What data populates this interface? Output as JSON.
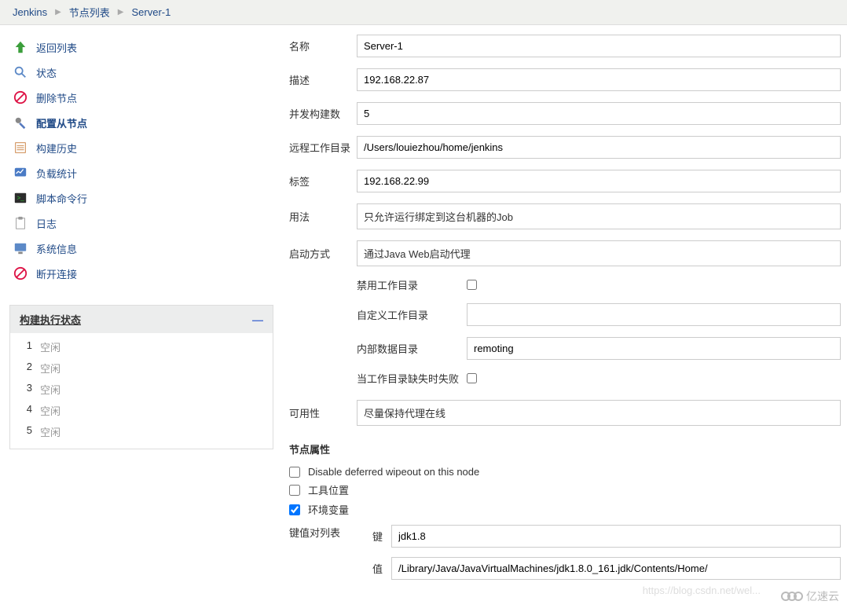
{
  "breadcrumb": [
    {
      "label": "Jenkins"
    },
    {
      "label": "节点列表"
    },
    {
      "label": "Server-1"
    }
  ],
  "sidebar": {
    "items": [
      {
        "label": "返回列表",
        "icon": "arrow-up",
        "name": "back-to-list"
      },
      {
        "label": "状态",
        "icon": "magnifier",
        "name": "status"
      },
      {
        "label": "删除节点",
        "icon": "no-entry",
        "name": "delete-node"
      },
      {
        "label": "配置从节点",
        "icon": "gear-wrench",
        "name": "configure-node",
        "bold": true
      },
      {
        "label": "构建历史",
        "icon": "notepad",
        "name": "build-history"
      },
      {
        "label": "负载统计",
        "icon": "monitor-chart",
        "name": "load-stats"
      },
      {
        "label": "脚本命令行",
        "icon": "terminal",
        "name": "script-console"
      },
      {
        "label": "日志",
        "icon": "clipboard",
        "name": "log"
      },
      {
        "label": "系统信息",
        "icon": "monitor",
        "name": "system-info"
      },
      {
        "label": "断开连接",
        "icon": "no-entry",
        "name": "disconnect"
      }
    ]
  },
  "executors": {
    "title": "构建执行状态",
    "rows": [
      {
        "num": "1",
        "state": "空闲"
      },
      {
        "num": "2",
        "state": "空闲"
      },
      {
        "num": "3",
        "state": "空闲"
      },
      {
        "num": "4",
        "state": "空闲"
      },
      {
        "num": "5",
        "state": "空闲"
      }
    ]
  },
  "form": {
    "labels": {
      "name": "名称",
      "desc": "描述",
      "executors": "并发构建数",
      "remote_fs": "远程工作目录",
      "labels": "标签",
      "usage": "用法",
      "launch": "启动方式",
      "disable_workdir": "禁用工作目录",
      "custom_workdir": "自定义工作目录",
      "internal_data_dir": "内部数据目录",
      "fail_if_missing": "当工作目录缺失时失败",
      "availability": "可用性",
      "node_props": "节点属性",
      "disable_wipeout": "Disable deferred wipeout on this node",
      "tool_location": "工具位置",
      "env_vars": "环境变量",
      "kv_list": "键值对列表",
      "key": "键",
      "value": "值"
    },
    "values": {
      "name": "Server-1",
      "desc": "192.168.22.87",
      "executors": "5",
      "remote_fs": "/Users/louiezhou/home/jenkins",
      "labels": "192.168.22.99",
      "usage": "只允许运行绑定到这台机器的Job",
      "launch": "通过Java Web启动代理",
      "disable_workdir": false,
      "custom_workdir": "",
      "internal_data_dir": "remoting",
      "fail_if_missing": false,
      "availability": "尽量保持代理在线",
      "disable_wipeout": false,
      "tool_location": false,
      "env_vars": true,
      "kv_key": "jdk1.8",
      "kv_value": "/Library/Java/JavaVirtualMachines/jdk1.8.0_161.jdk/Contents/Home/"
    }
  },
  "watermark": "https://blog.csdn.net/wel...",
  "brand": "亿速云"
}
